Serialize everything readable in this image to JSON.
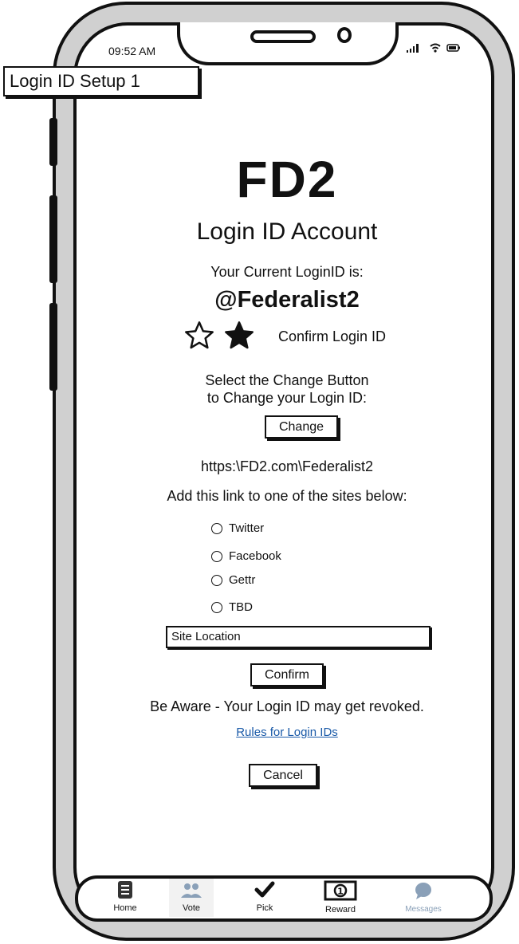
{
  "annotation_label": "Login ID Setup 1",
  "status_bar": {
    "time": "09:52 AM"
  },
  "brand": "FD2",
  "subtitle": "Login ID Account",
  "current_id_label": "Your Current LoginID is:",
  "current_id_value": "@Federalist2",
  "confirm_login_id": "Confirm Login ID",
  "instructions": [
    "Select the Change Button",
    "to Change your Login ID:"
  ],
  "change_button": "Change",
  "profile_link": "https:\\FD2.com\\Federalist2",
  "add_link_text": "Add this link to one of the sites below:",
  "sites": [
    "Twitter",
    "Facebook",
    "Gettr",
    "TBD"
  ],
  "site_location_placeholder": "Site Location",
  "confirm_button": "Confirm",
  "warning": "Be Aware - Your Login ID may get revoked.",
  "rules_link": "Rules for Login IDs",
  "cancel_button": "Cancel",
  "tabs": [
    {
      "label": "Home",
      "icon": "home-doc-icon"
    },
    {
      "label": "Vote",
      "icon": "people-icon"
    },
    {
      "label": "Pick",
      "icon": "check-icon"
    },
    {
      "label": "Reward",
      "icon": "money-icon"
    },
    {
      "label": "Messages",
      "icon": "chat-bubble-icon"
    }
  ],
  "colors": {
    "link": "#1a5aa8",
    "frame": "#d0d0d0",
    "icon_gray": "#8aa0b8"
  }
}
